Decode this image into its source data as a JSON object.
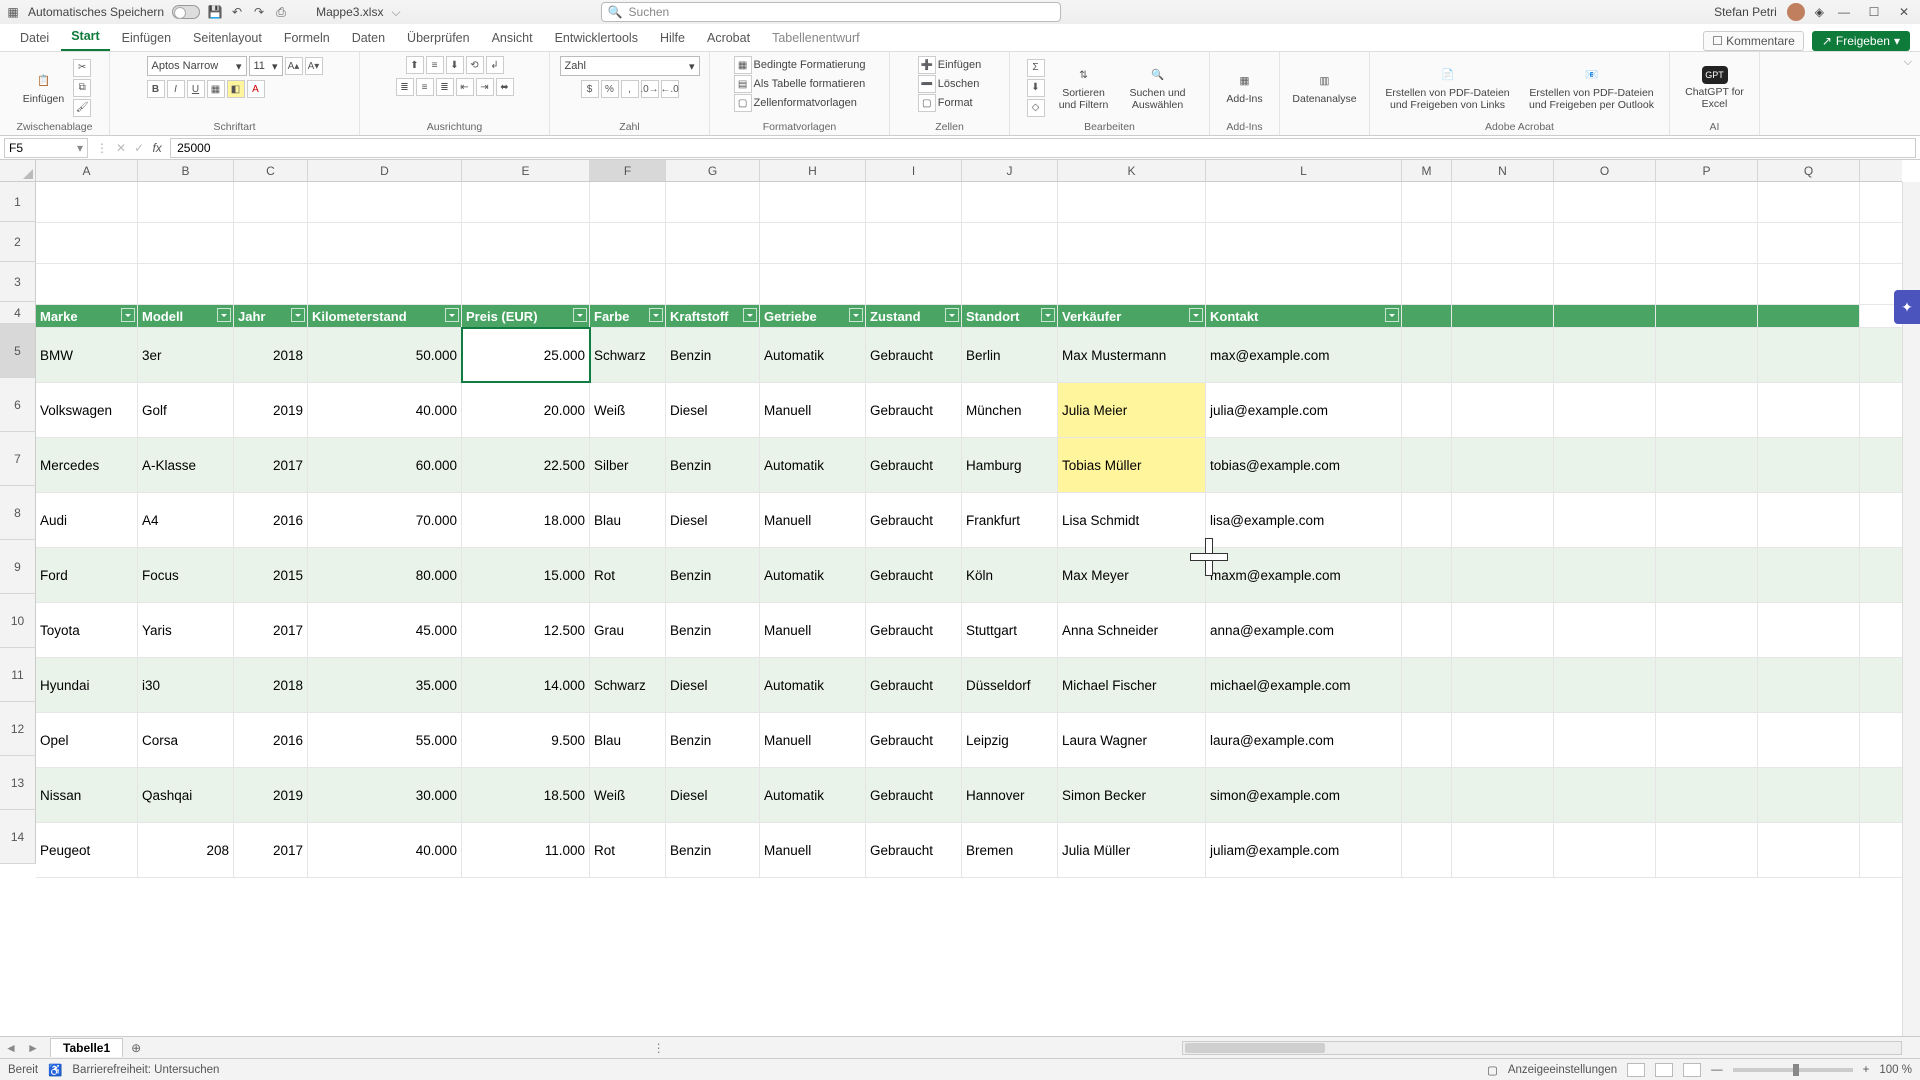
{
  "title": {
    "autosave": "Automatisches Speichern",
    "filename": "Mappe3.xlsx",
    "search_placeholder": "Suchen",
    "username": "Stefan Petri"
  },
  "tabs": {
    "datei": "Datei",
    "start": "Start",
    "einfuegen": "Einfügen",
    "seitenlayout": "Seitenlayout",
    "formeln": "Formeln",
    "daten": "Daten",
    "ueberpruefen": "Überprüfen",
    "ansicht": "Ansicht",
    "entwicklertools": "Entwicklertools",
    "hilfe": "Hilfe",
    "acrobat": "Acrobat",
    "tabellenentwurf": "Tabellenentwurf",
    "kommentare": "Kommentare",
    "freigeben": "Freigeben"
  },
  "ribbon": {
    "zwischenablage": "Zwischenablage",
    "einfuegen_btn": "Einfügen",
    "schriftart": "Schriftart",
    "fontname": "Aptos Narrow",
    "fontsize": "11",
    "ausrichtung": "Ausrichtung",
    "zahl": "Zahl",
    "numberformat": "Zahl",
    "formatvorlagen": "Formatvorlagen",
    "bedingte": "Bedingte Formatierung",
    "alstabelle": "Als Tabelle formatieren",
    "zellenfmt": "Zellenformatvorlagen",
    "zellen": "Zellen",
    "zeinfuegen": "Einfügen",
    "loeschen": "Löschen",
    "format": "Format",
    "bearbeiten": "Bearbeiten",
    "sortfilter": "Sortieren und Filtern",
    "suchen": "Suchen und Auswählen",
    "addins": "Add-Ins",
    "addins_btn": "Add-Ins",
    "datenanalyse": "Datenanalyse",
    "adobe": "Adobe Acrobat",
    "pdf1": "Erstellen von PDF-Dateien und Freigeben von Links",
    "pdf2": "Erstellen von PDF-Dateien und Freigeben per Outlook",
    "ai": "AI",
    "gpt": "ChatGPT for Excel"
  },
  "formula": {
    "namebox": "F5",
    "value": "25000"
  },
  "columns": [
    "A",
    "B",
    "C",
    "D",
    "E",
    "F",
    "G",
    "H",
    "I",
    "J",
    "K",
    "L",
    "M",
    "N",
    "O",
    "P",
    "Q"
  ],
  "headers": {
    "a": "Marke",
    "b": "Modell",
    "c": "Jahr",
    "d": "Kilometerstand",
    "e": "Preis (EUR)",
    "f": "Farbe",
    "g": "Kraftstoff",
    "h": "Getriebe",
    "i": "Zustand",
    "j": "Standort",
    "k": "Verkäufer",
    "l": "Kontakt"
  },
  "rows": [
    {
      "a": "BMW",
      "b": "3er",
      "c": "2018",
      "d": "50.000",
      "e": "25.000",
      "f": "Schwarz",
      "g": "Benzin",
      "h": "Automatik",
      "i": "Gebraucht",
      "j": "Berlin",
      "k": "Max Mustermann",
      "l": "max@example.com"
    },
    {
      "a": "Volkswagen",
      "b": "Golf",
      "c": "2019",
      "d": "40.000",
      "e": "20.000",
      "f": "Weiß",
      "g": "Diesel",
      "h": "Manuell",
      "i": "Gebraucht",
      "j": "München",
      "k": "Julia Meier",
      "l": "julia@example.com"
    },
    {
      "a": "Mercedes",
      "b": "A-Klasse",
      "c": "2017",
      "d": "60.000",
      "e": "22.500",
      "f": "Silber",
      "g": "Benzin",
      "h": "Automatik",
      "i": "Gebraucht",
      "j": "Hamburg",
      "k": "Tobias Müller",
      "l": "tobias@example.com"
    },
    {
      "a": "Audi",
      "b": "A4",
      "c": "2016",
      "d": "70.000",
      "e": "18.000",
      "f": "Blau",
      "g": "Diesel",
      "h": "Manuell",
      "i": "Gebraucht",
      "j": "Frankfurt",
      "k": "Lisa Schmidt",
      "l": "lisa@example.com"
    },
    {
      "a": "Ford",
      "b": "Focus",
      "c": "2015",
      "d": "80.000",
      "e": "15.000",
      "f": "Rot",
      "g": "Benzin",
      "h": "Automatik",
      "i": "Gebraucht",
      "j": "Köln",
      "k": "Max Meyer",
      "l": "maxm@example.com"
    },
    {
      "a": "Toyota",
      "b": "Yaris",
      "c": "2017",
      "d": "45.000",
      "e": "12.500",
      "f": "Grau",
      "g": "Benzin",
      "h": "Manuell",
      "i": "Gebraucht",
      "j": "Stuttgart",
      "k": "Anna Schneider",
      "l": "anna@example.com"
    },
    {
      "a": "Hyundai",
      "b": "i30",
      "c": "2018",
      "d": "35.000",
      "e": "14.000",
      "f": "Schwarz",
      "g": "Diesel",
      "h": "Automatik",
      "i": "Gebraucht",
      "j": "Düsseldorf",
      "k": "Michael Fischer",
      "l": "michael@example.com"
    },
    {
      "a": "Opel",
      "b": "Corsa",
      "c": "2016",
      "d": "55.000",
      "e": "9.500",
      "f": "Blau",
      "g": "Benzin",
      "h": "Manuell",
      "i": "Gebraucht",
      "j": "Leipzig",
      "k": "Laura Wagner",
      "l": "laura@example.com"
    },
    {
      "a": "Nissan",
      "b": "Qashqai",
      "c": "2019",
      "d": "30.000",
      "e": "18.500",
      "f": "Weiß",
      "g": "Diesel",
      "h": "Automatik",
      "i": "Gebraucht",
      "j": "Hannover",
      "k": "Simon Becker",
      "l": "simon@example.com"
    },
    {
      "a": "Peugeot",
      "b": "208",
      "c": "2017",
      "d": "40.000",
      "e": "11.000",
      "f": "Rot",
      "g": "Benzin",
      "h": "Manuell",
      "i": "Gebraucht",
      "j": "Bremen",
      "k": "Julia Müller",
      "l": "juliam@example.com"
    }
  ],
  "sheettab": "Tabelle1",
  "status": {
    "bereit": "Bereit",
    "barrierefrei": "Barrierefreiheit: Untersuchen",
    "anzeige": "Anzeigeeinstellungen",
    "zoom": "100 %"
  }
}
